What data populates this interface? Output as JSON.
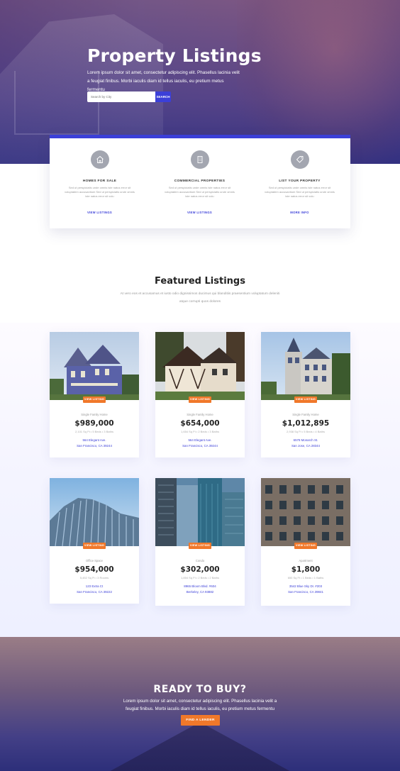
{
  "hero": {
    "title": "Property Listings",
    "subtitle": "Lorem ipsum dolor sit amet, consectetur adipiscing elit. Phasellus lacinia velit a feugiat finibus. Morbi iaculis diam id tellus iaculis, eu pretium metus fermentu",
    "search_placeholder": "Search by City",
    "search_button": "SEARCH"
  },
  "services": [
    {
      "icon": "home-icon",
      "title": "HOMES FOR SALE",
      "desc": "Sed ut perspiciatis unde omnis iste natus error sit voluptatem accusantium Sed ut perspiciatis unde omnis iste natus error sit volu",
      "link": "VIEW LISTINGS"
    },
    {
      "icon": "building-icon",
      "title": "COMMERCIAL PROPERTIES",
      "desc": "Sed ut perspiciatis unde omnis iste natus error sit voluptatem accusantium Sed ut perspiciatis unde omnis iste natus error sit volu",
      "link": "VIEW LISTINGS"
    },
    {
      "icon": "tag-icon",
      "title": "LIST YOUR PROPERTY",
      "desc": "Sed ut perspiciatis unde omnis iste natus error sit voluptatem accusantium Sed ut perspiciatis unde omnis iste natus error sit volu",
      "link": "MORE INFO"
    }
  ],
  "featured": {
    "title": "Featured Listings",
    "desc": "At vero eos et accusamus et iusto odio dignissimos ducimus qui blanditiis praesentium voluptatum deleniti atque corrupti quos dolores"
  },
  "listings": [
    {
      "button": "VIEW LISTING",
      "type": "Single Family Home",
      "price": "$989,000",
      "specs": "2,101 Sq Ft  •  5 Beds  •  3 Baths",
      "addr1": "564 Elegant Ave.",
      "addr2": "San Francisco, CA 39244"
    },
    {
      "button": "VIEW LISTING",
      "type": "Single Family Home",
      "price": "$654,000",
      "specs": "1,654 Sq Ft  •  2 Beds  •  3 Baths",
      "addr1": "564 Elegant Ave.",
      "addr2": "San Francisco, CA 39244"
    },
    {
      "button": "VIEW LISTING",
      "type": "Single Family Home",
      "price": "$1,012,895",
      "specs": "2,938 Sq Ft  •  5 Beds  •  4 Baths",
      "addr1": "6578 Monarch St.",
      "addr2": "San Jose, CA 28344"
    },
    {
      "button": "VIEW LISTING",
      "type": "Office Space",
      "price": "$954,000",
      "specs": "5,452 Sq Ft  •  3 Rooms",
      "addr1": "123 Extra Ct",
      "addr2": "San Francisco, CA 39222"
    },
    {
      "button": "VIEW LISTING",
      "type": "Condo",
      "price": "$302,000",
      "specs": "1,854 Sq Ft  •  2 Beds  •  2 Baths",
      "addr1": "8965 Bloom Blvd. #604",
      "addr2": "Berkeley, CA 93882"
    },
    {
      "button": "VIEW LISTING",
      "type": "Apartment",
      "price": "$1,800",
      "specs": "650 Sq Ft  •  1 Beds  •  1 Baths",
      "addr1": "3542 Blue Sky Dr. #203",
      "addr2": "San Francisco, CA 39841"
    }
  ],
  "cta": {
    "title": "READY TO BUY?",
    "desc": "Lorem ipsum dolor sit amet, consectetur adipiscing elit. Phasellus lacinia velit a feugiat finibus. Morbi iaculis diam id tellus iaculis, eu pretium metus fermentu",
    "button": "FIND A LENDER"
  },
  "colors": {
    "accent": "#3b3fd8",
    "orange": "#f0782a"
  }
}
